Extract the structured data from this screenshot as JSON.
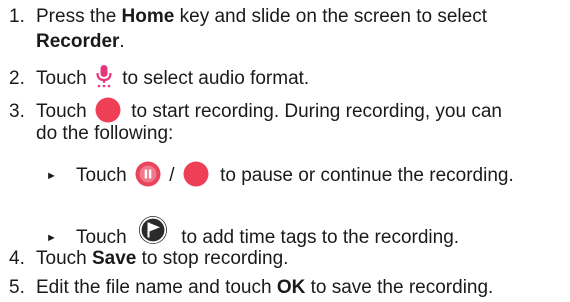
{
  "steps": [
    {
      "number": "1.",
      "text_a": "Press the ",
      "bold_a": "Home",
      "text_b": " key and slide on the screen to select",
      "line2_bold": "Recorder",
      "line2_text": "."
    },
    {
      "number": "2.",
      "text_a": "Touch ",
      "icon": "microphone-settings-icon",
      "text_b": " to select audio format."
    },
    {
      "number": "3.",
      "text_a": "Touch ",
      "icon": "record-button-icon",
      "text_b": " to start recording. During recording, you can",
      "line2_text": "do the following:",
      "substeps": [
        {
          "bullet": "►",
          "text_a": "Touch ",
          "icon_1": "pause-button-icon",
          "separator": " / ",
          "icon_2": "record-button-icon",
          "text_b": " to pause or continue the recording."
        },
        {
          "bullet": "►",
          "text_a": "Touch ",
          "icon": "time-tag-flag-icon",
          "text_b": " to add time tags to the recording."
        }
      ]
    },
    {
      "number": "4.",
      "text_a": "Touch ",
      "bold_a": "Save",
      "text_b": " to stop recording."
    },
    {
      "number": "5.",
      "text_a": "Edit the file name and touch ",
      "bold_a": "OK",
      "text_b": " to save the recording."
    }
  ],
  "colors": {
    "text": "#1a1a1a",
    "record_red": "#ee3f57",
    "pause_red": "#e8455c",
    "mic_pink": "#e8367a",
    "flag_bg": "#2a2a2a"
  }
}
